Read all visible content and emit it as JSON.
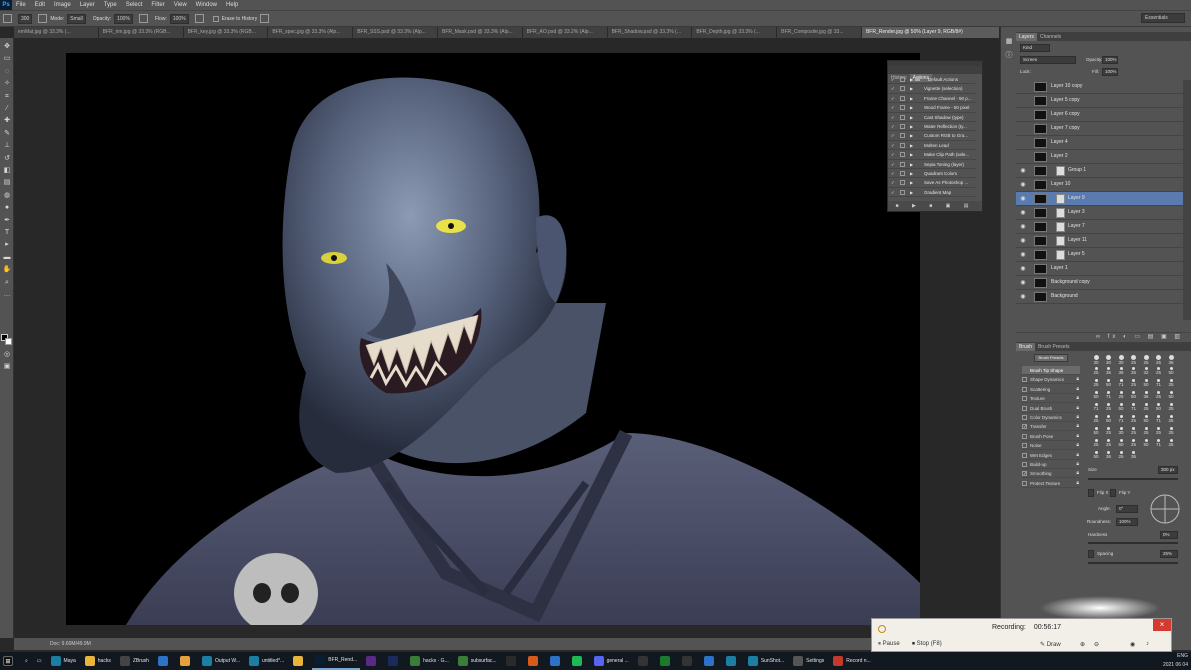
{
  "app": {
    "logo": "Ps"
  },
  "menu": [
    "File",
    "Edit",
    "Image",
    "Layer",
    "Type",
    "Select",
    "Filter",
    "View",
    "Window",
    "Help"
  ],
  "options_bar": {
    "mode_label": "Mode:",
    "mode_value": "Small",
    "opacity_label": "Opacity:",
    "opacity_value": "100%",
    "flow_label": "Flow:",
    "flow_value": "100%",
    "erase_history": "Erase to History",
    "workspace": "Essentials"
  },
  "doc_tabs": [
    {
      "label": "emMat.jpg @ 33.3% (...",
      "active": false
    },
    {
      "label": "BFR_rim.jpg @ 33.3% (RGB...",
      "active": false
    },
    {
      "label": "BFR_key.jpg @ 33.3% (RGB...",
      "active": false
    },
    {
      "label": "BFR_spec.jpg @ 33.3% (Alp...",
      "active": false
    },
    {
      "label": "BFR_SSS.psd @ 33.3% (Alp...",
      "active": false
    },
    {
      "label": "BFR_Mask.psd @ 33.3% (Alp...",
      "active": false
    },
    {
      "label": "BFR_AO.psd @ 33.2% (Alp...",
      "active": false
    },
    {
      "label": "BFR_Shadow.psd @ 33.3% (...",
      "active": false
    },
    {
      "label": "BFR_Depth.jpg @ 33.3% (...",
      "active": false
    },
    {
      "label": "BFR_Composite.jpg @ 33...",
      "active": false
    },
    {
      "label": "BFR_Render.jpg @ 50% (Layer 9, RGB/8#)",
      "active": true
    }
  ],
  "status": {
    "zoom": "Doc: 9.60M/49.9M"
  },
  "history": {
    "tabs": [
      "History",
      "Actions"
    ],
    "rows": [
      "Default Actions",
      "Vignette (selection)",
      "Frame Channel - 50 p...",
      "Wood Frame - 50 pixel",
      "Cast Shadow (type)",
      "Water Reflection (ty...",
      "Custom RGB to Gra...",
      "Molten Lead",
      "Make Clip Path (sele...",
      "Sepia Toning (layer)",
      "Quadrant Colors",
      "Save As Photoshop ...",
      "Gradient Map"
    ]
  },
  "layers_panel": {
    "tabs": [
      "Layers",
      "Channels"
    ],
    "kind": "Kind",
    "blend": "Screen",
    "opacity_label": "Opacity:",
    "opacity_value": "100%",
    "lock_label": "Lock:",
    "fill_label": "Fill:",
    "fill_value": "100%",
    "layers": [
      {
        "name": "Layer 10 copy",
        "visible": false,
        "mask": false,
        "selected": false
      },
      {
        "name": "Layer 5 copy",
        "visible": false,
        "mask": false,
        "selected": false
      },
      {
        "name": "Layer 6 copy",
        "visible": false,
        "mask": false,
        "selected": false
      },
      {
        "name": "Layer 7 copy",
        "visible": false,
        "mask": false,
        "selected": false
      },
      {
        "name": "Layer 4",
        "visible": false,
        "mask": false,
        "selected": false
      },
      {
        "name": "Layer 2",
        "visible": false,
        "mask": false,
        "selected": false
      },
      {
        "name": "Group 1",
        "visible": true,
        "mask": true,
        "selected": false
      },
      {
        "name": "Layer 10",
        "visible": true,
        "mask": false,
        "selected": false
      },
      {
        "name": "Layer 9",
        "visible": true,
        "mask": true,
        "selected": true
      },
      {
        "name": "Layer 3",
        "visible": true,
        "mask": true,
        "selected": false
      },
      {
        "name": "Layer 7",
        "visible": true,
        "mask": true,
        "selected": false
      },
      {
        "name": "Layer 11",
        "visible": true,
        "mask": true,
        "selected": false
      },
      {
        "name": "Layer 5",
        "visible": true,
        "mask": true,
        "selected": false
      },
      {
        "name": "Layer 1",
        "visible": true,
        "mask": false,
        "selected": false
      },
      {
        "name": "Background copy",
        "visible": true,
        "mask": false,
        "selected": false
      },
      {
        "name": "Background",
        "visible": true,
        "mask": false,
        "selected": false
      }
    ]
  },
  "brush_panel": {
    "tabs": [
      "Brush",
      "Brush Presets"
    ],
    "presets_button": "Brush Presets",
    "options": [
      {
        "label": "Brush Tip Shape",
        "checked": false,
        "selected": true
      },
      {
        "label": "Shape Dynamics",
        "checked": false,
        "selected": false
      },
      {
        "label": "Scattering",
        "checked": false,
        "selected": false
      },
      {
        "label": "Texture",
        "checked": false,
        "selected": false
      },
      {
        "label": "Dual Brush",
        "checked": false,
        "selected": false
      },
      {
        "label": "Color Dynamics",
        "checked": false,
        "selected": false
      },
      {
        "label": "Transfer",
        "checked": true,
        "selected": false
      },
      {
        "label": "Brush Pose",
        "checked": false,
        "selected": false
      },
      {
        "label": "Noise",
        "checked": false,
        "selected": false
      },
      {
        "label": "Wet Edges",
        "checked": false,
        "selected": false
      },
      {
        "label": "Build-up",
        "checked": false,
        "selected": false
      },
      {
        "label": "Smoothing",
        "checked": true,
        "selected": false
      },
      {
        "label": "Protect Texture",
        "checked": false,
        "selected": false
      }
    ],
    "tip_sizes": [
      "30",
      "30",
      "30",
      "25",
      "25",
      "25",
      "36",
      "25",
      "36",
      "36",
      "36",
      "32",
      "25",
      "50",
      "25",
      "50",
      "71",
      "25",
      "50",
      "71",
      "25",
      "50",
      "71",
      "25",
      "50",
      "36",
      "25",
      "50",
      "71",
      "25",
      "50",
      "71",
      "25",
      "50",
      "25",
      "25",
      "50",
      "71",
      "25",
      "50",
      "71",
      "25",
      "50",
      "25",
      "30",
      "25",
      "25",
      "25",
      "25",
      "25",
      "25",
      "50",
      "25",
      "50",
      "71",
      "25",
      "50",
      "36",
      "25",
      "36"
    ],
    "size_label": "Size",
    "size_value": "300 px",
    "flip_x": "Flip X",
    "flip_y": "Flip Y",
    "angle_label": "Angle:",
    "angle_value": "0°",
    "roundness_label": "Roundness:",
    "roundness_value": "100%",
    "hardness_label": "Hardness",
    "hardness_value": "0%",
    "spacing_label": "Spacing",
    "spacing_value": "25%"
  },
  "recording": {
    "title": "Recording:",
    "time": "00:56:17",
    "pause": "Pause",
    "stop": "Stop",
    "stop_key": "(F8)",
    "draw": "Draw"
  },
  "taskbar": [
    {
      "label": "Maya",
      "icon_color": "#1b7fa3",
      "active": false
    },
    {
      "label": "hacks",
      "icon_color": "#e8b43a",
      "active": false
    },
    {
      "label": "ZBrush",
      "icon_color": "#444",
      "active": false
    },
    {
      "label": "",
      "icon_color": "#2c73c7",
      "active": false
    },
    {
      "label": "",
      "icon_color": "#e6a23a",
      "active": false
    },
    {
      "label": "Output W...",
      "icon_color": "#1b7fa3",
      "active": false
    },
    {
      "label": "untitled*...",
      "icon_color": "#1b7fa3",
      "active": false
    },
    {
      "label": "",
      "icon_color": "#e8b43a",
      "active": false
    },
    {
      "label": "BFR_Rend...",
      "icon_color": "#0a1d33",
      "active": true
    },
    {
      "label": "",
      "icon_color": "#5b2a86",
      "active": false
    },
    {
      "label": "",
      "icon_color": "#1b2a5c",
      "active": false
    },
    {
      "label": "hacks · G...",
      "icon_color": "#3a7d3a",
      "active": false
    },
    {
      "label": "subsurfac...",
      "icon_color": "#3a7d3a",
      "active": false
    },
    {
      "label": "",
      "icon_color": "#2a2a2a",
      "active": false
    },
    {
      "label": "",
      "icon_color": "#d85a1a",
      "active": false
    },
    {
      "label": "",
      "icon_color": "#2c73c7",
      "active": false
    },
    {
      "label": "",
      "icon_color": "#1db954",
      "active": false
    },
    {
      "label": "general ...",
      "icon_color": "#5865f2",
      "active": false
    },
    {
      "label": "",
      "icon_color": "#333",
      "active": false
    },
    {
      "label": "",
      "icon_color": "#1b7a2c",
      "active": false
    },
    {
      "label": "",
      "icon_color": "#333",
      "active": false
    },
    {
      "label": "",
      "icon_color": "#2c73c7",
      "active": false
    },
    {
      "label": "",
      "icon_color": "#1b7fa3",
      "active": false
    },
    {
      "label": "SunShot...",
      "icon_color": "#1b7fa3",
      "active": false
    },
    {
      "label": "Settings",
      "icon_color": "#555",
      "active": false
    },
    {
      "label": "Record n...",
      "icon_color": "#c43a2a",
      "active": false
    }
  ],
  "tray": {
    "lang": "ENG",
    "date": "2021 06 04"
  }
}
